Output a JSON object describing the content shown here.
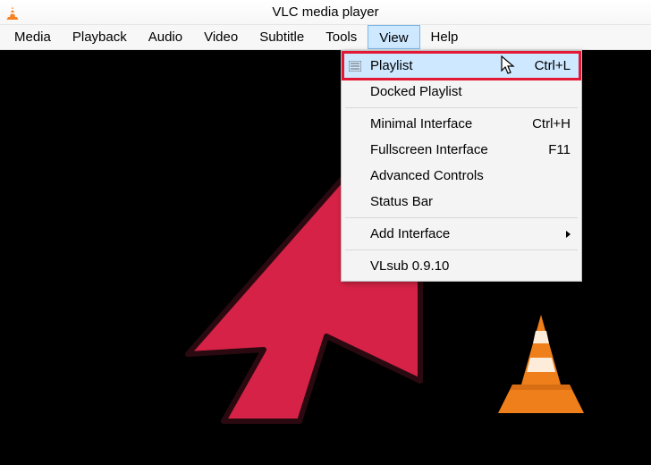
{
  "title": "VLC media player",
  "menu": {
    "items": [
      "Media",
      "Playback",
      "Audio",
      "Video",
      "Subtitle",
      "Tools",
      "View",
      "Help"
    ],
    "active_index": 6
  },
  "dropdown": {
    "items": [
      {
        "label": "Playlist",
        "shortcut": "Ctrl+L",
        "has_icon": true,
        "highlighted": true
      },
      {
        "label": "Docked Playlist"
      },
      {
        "sep": true
      },
      {
        "label": "Minimal Interface",
        "shortcut": "Ctrl+H"
      },
      {
        "label": "Fullscreen Interface",
        "shortcut": "F11"
      },
      {
        "label": "Advanced Controls"
      },
      {
        "label": "Status Bar"
      },
      {
        "sep": true
      },
      {
        "label": "Add Interface",
        "submenu": true
      },
      {
        "sep": true
      },
      {
        "label": "VLsub 0.9.10"
      }
    ]
  },
  "annotations": {
    "big_red_arrow": true,
    "cursor_over_playlist": true
  }
}
